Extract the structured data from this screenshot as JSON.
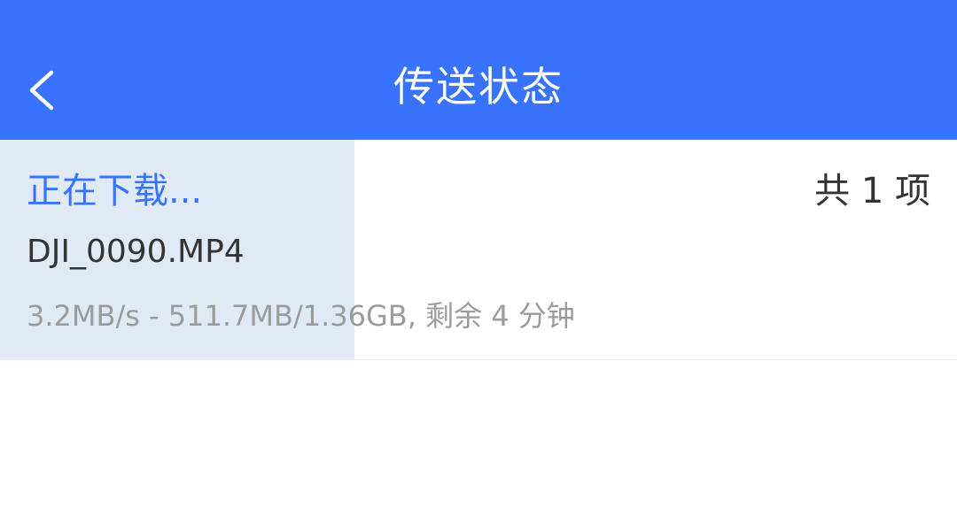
{
  "header": {
    "title": "传送状态",
    "back_icon": "chevron-left-icon",
    "background_color": "#3873fe"
  },
  "transfer": {
    "status": "正在下载...",
    "count": "共 1 项",
    "file_name": "DJI_0090.MP4",
    "detail": "3.2MB/s - 511.7MB/1.36GB, 剩余 4 分钟",
    "progress": 0.37,
    "progress_color": "#dfeaf5",
    "status_color": "#3873fe"
  }
}
